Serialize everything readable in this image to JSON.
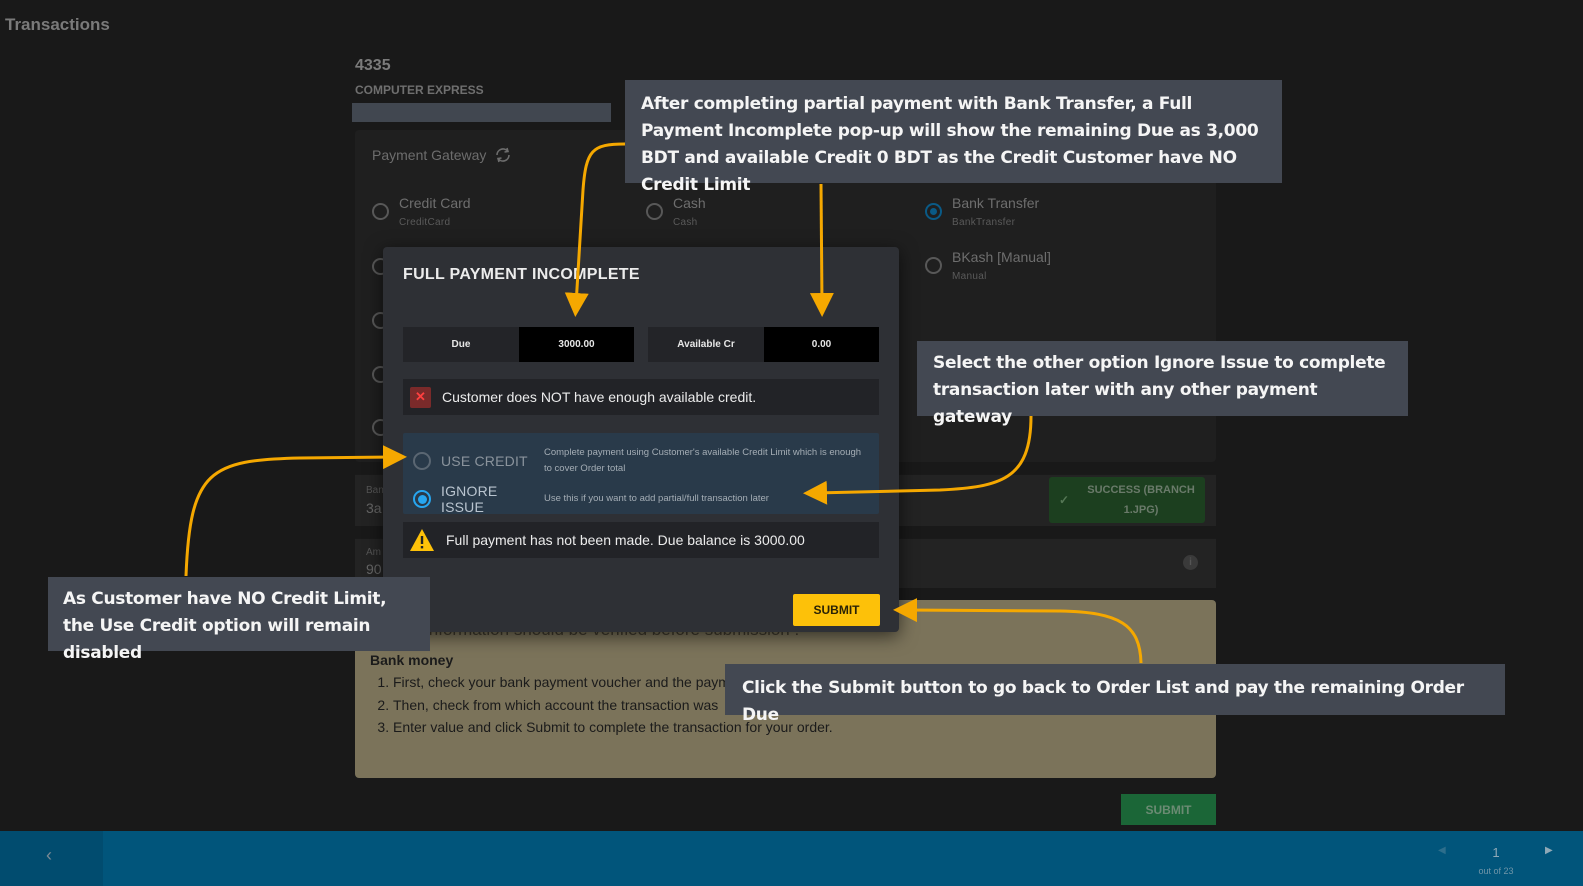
{
  "app": {
    "title": "Transactions"
  },
  "order": {
    "number": "4335",
    "customer": "COMPUTER EXPRESS"
  },
  "gateway": {
    "title": "Payment Gateway",
    "refresh_icon": "refresh-icon",
    "options": [
      {
        "label": "Credit Card",
        "sub": "CreditCard",
        "selected": false
      },
      {
        "label": "Cash",
        "sub": "Cash",
        "selected": false
      },
      {
        "label": "Bank Transfer",
        "sub": "BankTransfer",
        "selected": true
      },
      {
        "label": "BKash [Manual]",
        "sub": "Manual",
        "selected": false
      }
    ]
  },
  "fields": {
    "bank_label": "Ban",
    "bank_value": "3a",
    "amount_label": "Am",
    "amount_value": "90"
  },
  "success_badge": {
    "text": "SUCCESS (BRANCH 1.JPG)",
    "icon": "check-icon"
  },
  "instructions": {
    "heading_partial": "information should be verified before submission :",
    "section": "Bank money",
    "steps": [
      "First, check your bank payment voucher and the paym",
      "Then, check from which account the transaction was",
      "Enter value and click Submit to complete the transaction for your order."
    ]
  },
  "main_submit_label": "SUBMIT",
  "pager": {
    "page": "1",
    "total_label": "out of 23"
  },
  "modal": {
    "title": "FULL PAYMENT INCOMPLETE",
    "due_label": "Due",
    "due_value": "3000.00",
    "credit_label": "Available Cr",
    "credit_value": "0.00",
    "error_text": "Customer does NOT have enough available credit.",
    "options": [
      {
        "label": "USE CREDIT",
        "desc": "Complete payment using Customer's available Credit Limit which is enough to cover Order total",
        "selected": false,
        "disabled": true
      },
      {
        "label": "IGNORE ISSUE",
        "desc": "Use this if you want to add partial/full transaction later",
        "selected": true,
        "disabled": false
      }
    ],
    "warning_text": "Full payment has not been made. Due balance is 3000.00",
    "submit_label": "SUBMIT"
  },
  "callouts": [
    "After completing partial payment with Bank Transfer, a Full Payment Incomplete pop-up will show the remaining Due as 3,000 BDT and available Credit 0 BDT as the Credit Customer have NO Credit Limit",
    "Select the other option Ignore Issue to complete transaction later with any other payment gateway",
    "As Customer have NO Credit Limit, the Use Credit option will remain disabled",
    "Click the Submit button to go back to Order List and pay the remaining Order Due"
  ],
  "colors": {
    "accent_yellow": "#fdc109",
    "arrow": "#f5a800",
    "bottom_bar": "#01557b",
    "radio_selected": "#27a6f0",
    "success_green": "#1c3f1f"
  }
}
